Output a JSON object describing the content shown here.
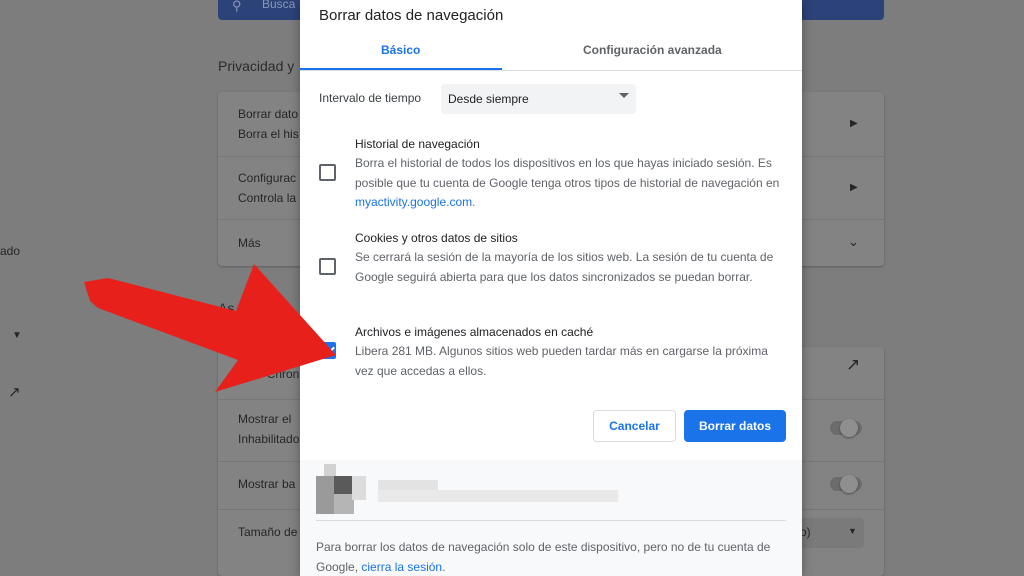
{
  "background": {
    "search_placeholder": "Busca",
    "section_privacy": "Privacidad y",
    "section_appearance": "As",
    "rows": [
      {
        "line1": "Borrar dato",
        "line2": "Borra el his"
      },
      {
        "line1": "Configurac",
        "line2": "Controla la"
      },
      {
        "line1": "Más"
      },
      {
        "line1": "Abrir Chron"
      },
      {
        "line1": "Mostrar el",
        "line2": "Inhabilitado"
      },
      {
        "line1": "Mostrar ba"
      },
      {
        "line1": "Tamaño de"
      }
    ],
    "left_nav_text": "ado",
    "font_size_select": "o)"
  },
  "dialog": {
    "title": "Borrar datos de navegación",
    "tabs": [
      {
        "label": "Básico",
        "active": true
      },
      {
        "label": "Configuración avanzada",
        "active": false
      }
    ],
    "time_range": {
      "label": "Intervalo de tiempo",
      "value": "Desde siempre"
    },
    "items": [
      {
        "title": "Historial de navegación",
        "desc_before": "Borra el historial de todos los dispositivos en los que hayas iniciado sesión. Es posible que tu cuenta de Google tenga otros tipos de historial de navegación en ",
        "link": "myactivity.google.com",
        "desc_after": ".",
        "checked": false
      },
      {
        "title": "Cookies y otros datos de sitios",
        "desc": "Se cerrará la sesión de la mayoría de los sitios web. La sesión de tu cuenta de Google seguirá abierta para que los datos sincronizados se puedan borrar.",
        "checked": false
      },
      {
        "title": "Archivos e imágenes almacenados en caché",
        "desc": "Libera 281 MB. Algunos sitios web pueden tardar más en cargarse la próxima vez que accedas a ellos.",
        "checked": true
      }
    ],
    "buttons": {
      "cancel": "Cancelar",
      "clear": "Borrar datos"
    },
    "footer": {
      "text_before": "Para borrar los datos de navegación solo de este dispositivo, pero no de tu cuenta de Google, ",
      "link": "cierra la sesión",
      "text_after": "."
    }
  },
  "colors": {
    "accent": "#1a73e8",
    "annotation_arrow": "#e8201b",
    "overlay": "#7d7d7d"
  }
}
